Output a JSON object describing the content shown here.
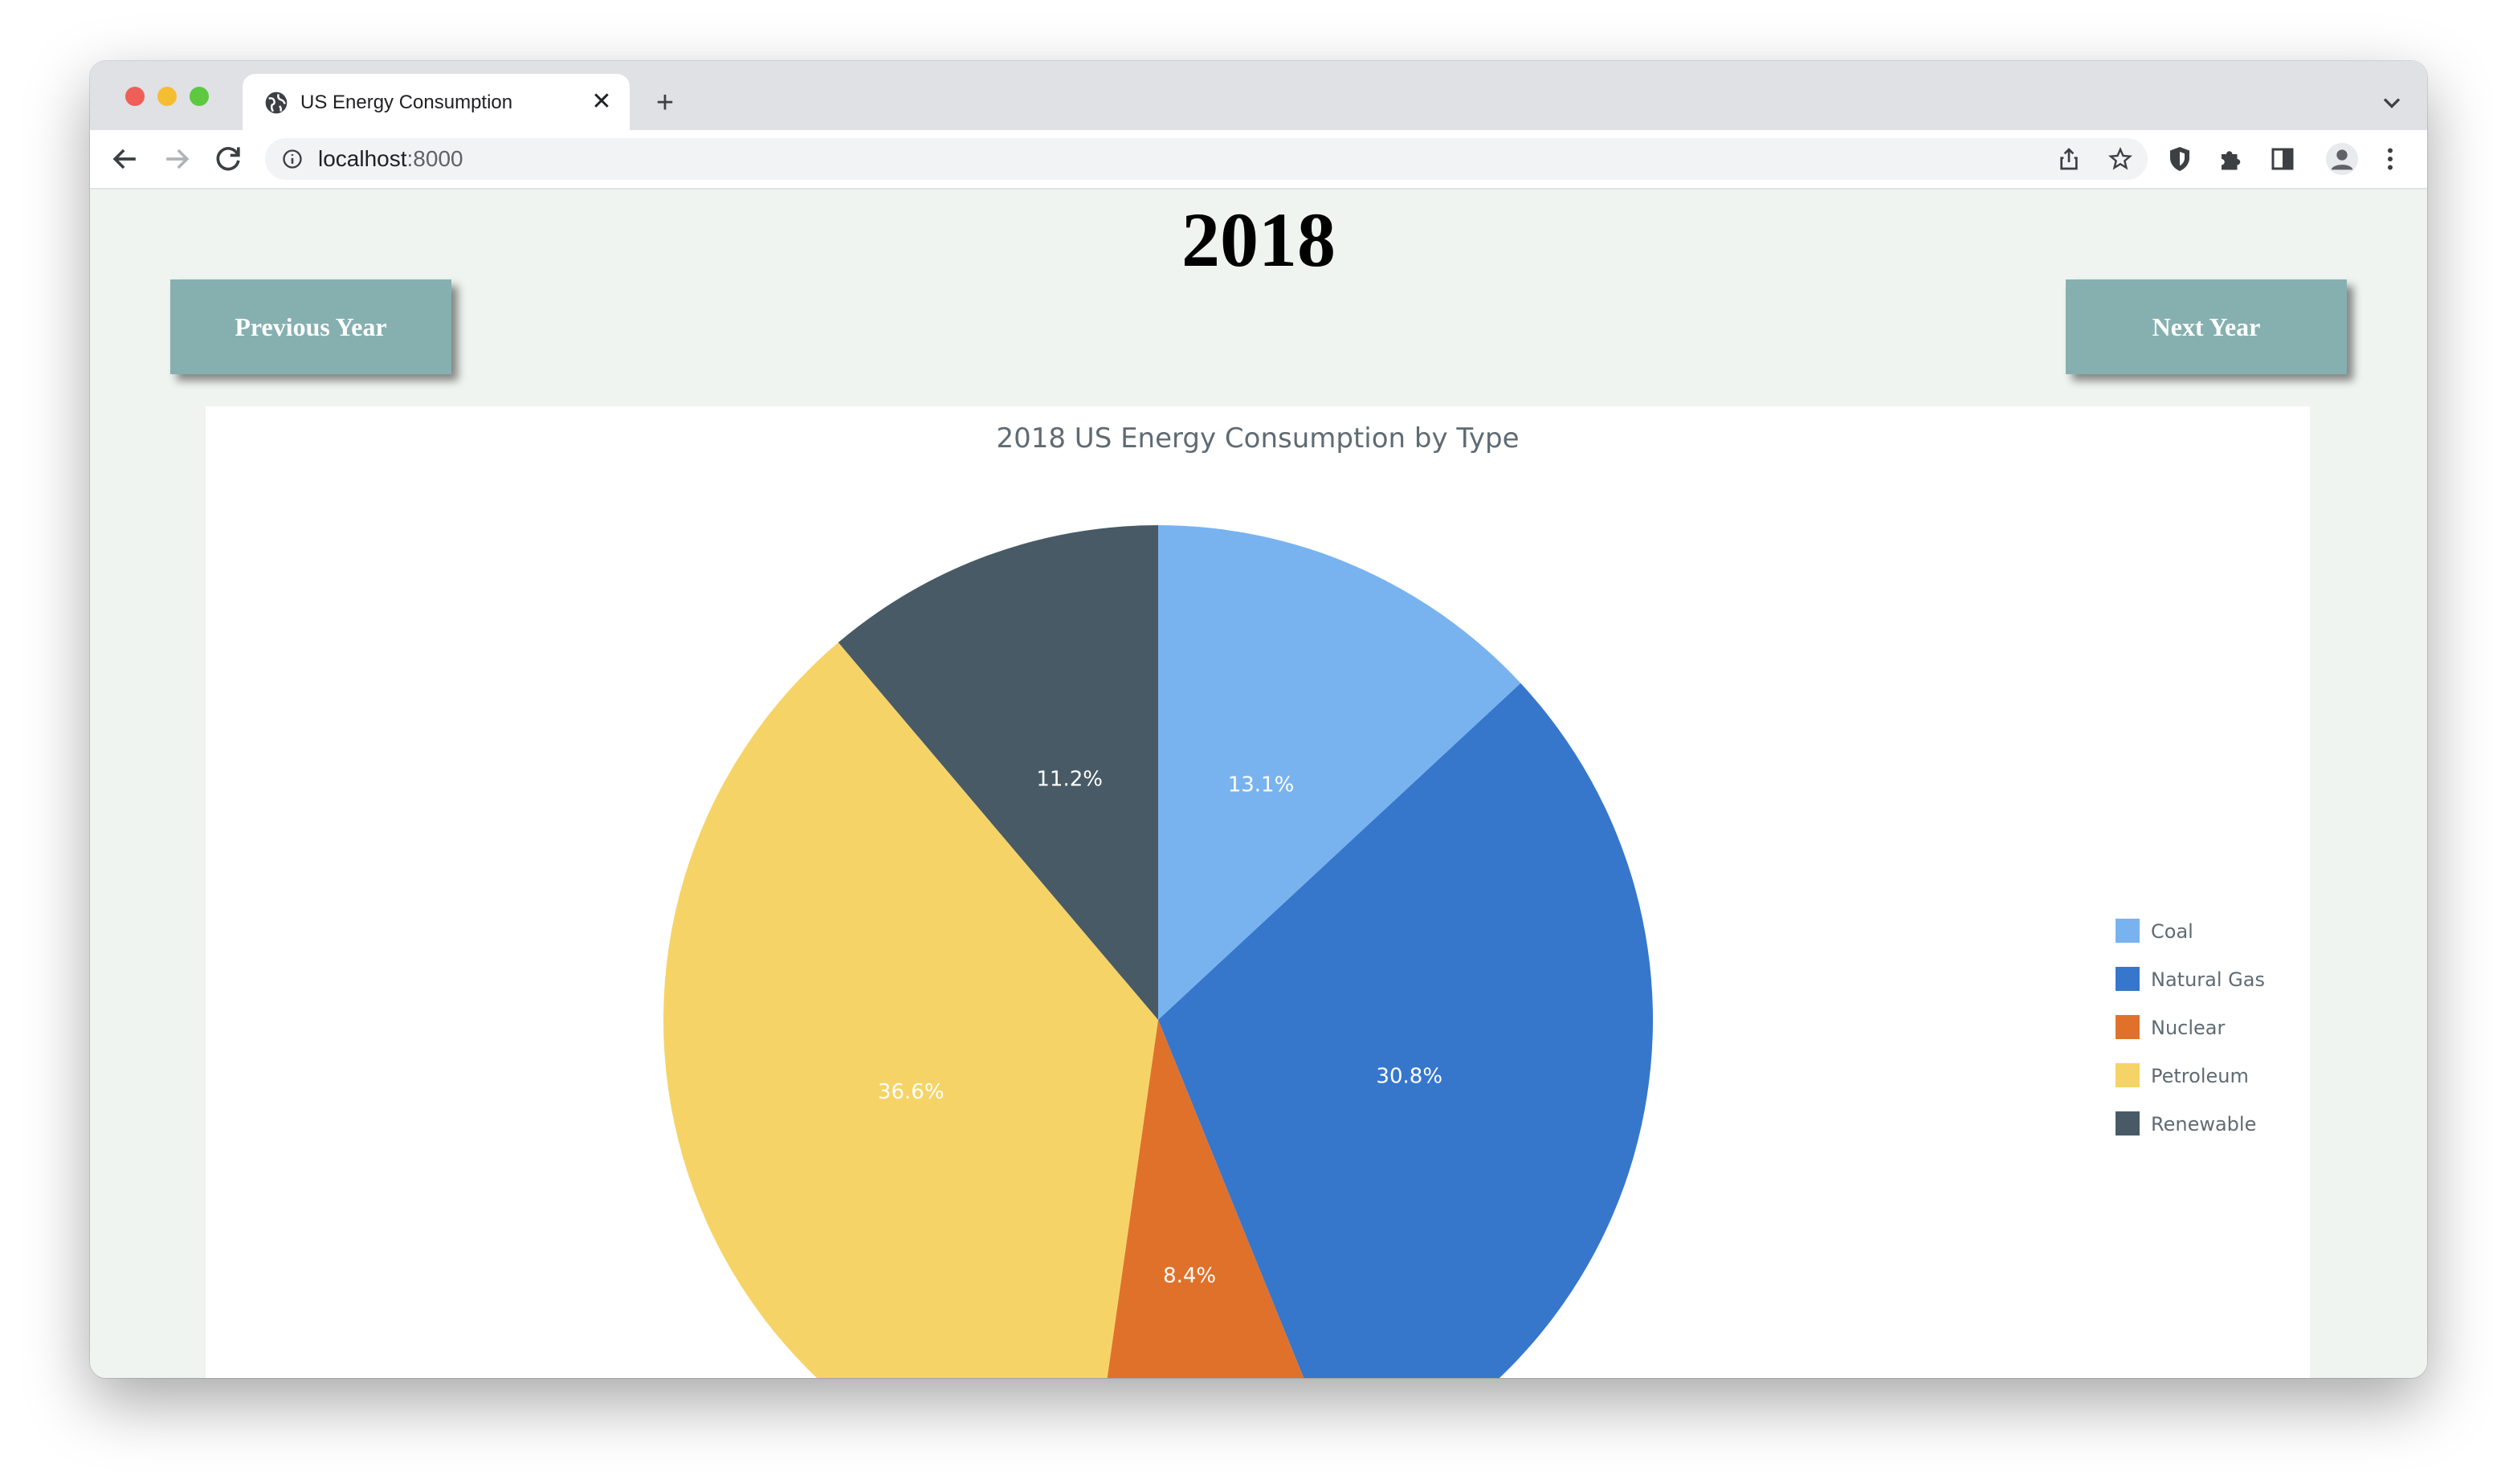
{
  "browser": {
    "tab_title": "US Energy Consumption",
    "tab_close": "✕",
    "new_tab": "+",
    "url_host": "localhost",
    "url_port": ":8000"
  },
  "page": {
    "year_heading": "2018",
    "prev_button": "Previous Year",
    "next_button": "Next Year"
  },
  "chart_data": {
    "type": "pie",
    "title": "2018 US Energy Consumption by Type",
    "legend_position": "right",
    "slices": [
      {
        "label": "Coal",
        "value": 13.1,
        "text": "13.1%",
        "color": "#78b3f0"
      },
      {
        "label": "Natural Gas",
        "value": 30.8,
        "text": "30.8%",
        "color": "#3677cc"
      },
      {
        "label": "Nuclear",
        "value": 8.4,
        "text": "8.4%",
        "color": "#e0712b"
      },
      {
        "label": "Petroleum",
        "value": 36.6,
        "text": "36.6%",
        "color": "#f6d366"
      },
      {
        "label": "Renewable",
        "value": 11.2,
        "text": "11.2%",
        "color": "#485a65"
      }
    ]
  }
}
